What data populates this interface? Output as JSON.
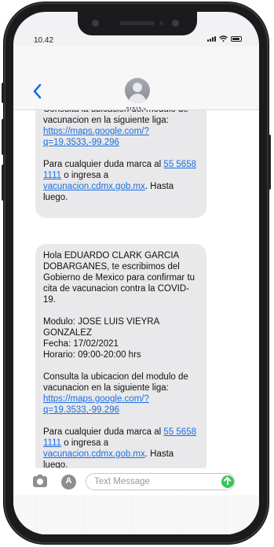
{
  "status": {
    "time": "10.42"
  },
  "header": {
    "contact": "51515 >"
  },
  "messages": [
    {
      "p1": "Consulta la ubicacion del modulo de vacunacion en la siguiente liga:",
      "p1_link": "https://maps.google.com/?q=19.3533,-99.296",
      "p2_a": "Para cualquier duda marca al ",
      "p2_link1": "55 5658 1111",
      "p2_b": " o ingresa a ",
      "p2_link2": "vacunacion.cdmx.gob.mx",
      "p2_c": ". Hasta luego."
    },
    {
      "p0": "Hola EDUARDO CLARK GARCIA DOBARGANES, te escribimos del Gobierno de Mexico para confirmar tu cita de vacunacion contra la COVID-19.",
      "modulo": "Modulo: JOSE LUIS VIEYRA GONZALEZ",
      "fecha": "Fecha: 17/02/2021",
      "horario": "Horario: 09:00-20:00 hrs",
      "p1": "Consulta la ubicacion del modulo de vacunacion en la siguiente liga:",
      "p1_link": "https://maps.google.com/?q=19.3533,-99.296",
      "p2_a": "Para cualquier duda marca al ",
      "p2_link1": "55 5658 1111",
      "p2_b": " o ingresa a ",
      "p2_link2": "vacunacion.cdmx.gob.mx",
      "p2_c": ". Hasta luego."
    }
  ],
  "input": {
    "placeholder": "Text Message"
  },
  "icons": {
    "camera": "camera-icon",
    "apps": "app-store-icon",
    "send": "send-arrow-icon",
    "back": "chevron-left-icon"
  },
  "colors": {
    "link": "#1a6fe0",
    "send": "#34c759",
    "bubble": "#e9e9eb"
  }
}
